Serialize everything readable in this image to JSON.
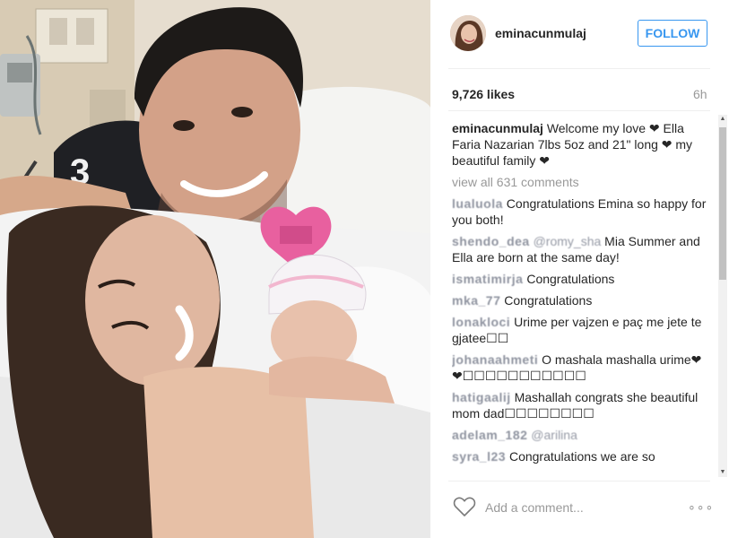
{
  "post": {
    "username": "eminacunmulaj",
    "follow_label": "FOLLOW",
    "likes": "9,726 likes",
    "time": "6h",
    "caption": {
      "username": "eminacunmulaj",
      "text": "Welcome my love ❤ Ella Faria Nazarian 7lbs 5oz and 21\" long ❤ my beautiful family ❤"
    },
    "view_all": "view all 631 comments",
    "comments": [
      {
        "username": "lualuola",
        "text": "Congratulations Emina so happy for you both!"
      },
      {
        "username": "shendo_dea",
        "mention": "@romy_sha",
        "text": "Mia Summer and Ella are born at the same day!"
      },
      {
        "username": "ismatimirja",
        "text": "Congratulations"
      },
      {
        "username": "mka_77",
        "text": "Congratulations"
      },
      {
        "username": "lonakloci",
        "text": "Urime per vajzen e paç me jete te gjatee☐☐"
      },
      {
        "username": "johanaahmeti",
        "text": "O mashala mashalla urime❤❤☐☐☐☐☐☐☐☐☐☐☐"
      },
      {
        "username": "hatigaalij",
        "text": "Mashallah congrats she beautiful mom dad☐☐☐☐☐☐☐☐"
      },
      {
        "username": "adelam_182",
        "mention": "@arilina",
        "text": ""
      },
      {
        "username": "syra_l23",
        "text": "Congratulations we are so"
      }
    ],
    "add_comment_placeholder": "Add a comment...",
    "more_label": "∘∘∘"
  },
  "icons": {
    "heart": "heart-icon",
    "more": "more-options-icon",
    "scroll_up": "scroll-up-arrow-icon",
    "scroll_down": "scroll-down-arrow-icon"
  },
  "colors": {
    "accent": "#3897f0",
    "text": "#262626",
    "muted": "#999999",
    "divider": "#efefef"
  }
}
